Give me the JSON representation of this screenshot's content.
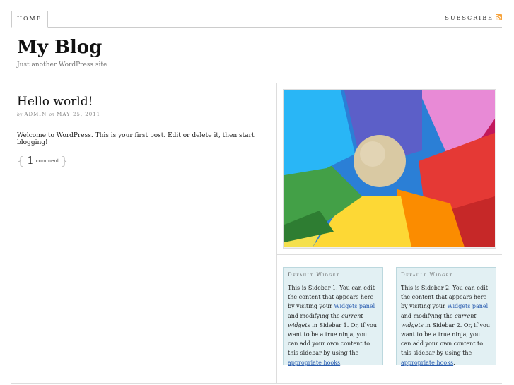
{
  "nav": {
    "home_label": "HOME",
    "subscribe_label": "SUBSCRIBE",
    "rss_icon": "rss-icon",
    "rss_color": "#f7a33b"
  },
  "header": {
    "title": "My Blog",
    "tagline": "Just another WordPress site"
  },
  "post": {
    "title": "Hello world!",
    "meta_by": "by",
    "author": "ADMIN",
    "meta_on": "on",
    "date": "MAY 25, 2011",
    "body": "Welcome to WordPress. This is your first post. Edit or delete it, then start blogging!",
    "comment_count": "1",
    "comment_label": "comment",
    "brace_open": "{",
    "brace_close": "}"
  },
  "sidebar": {
    "image_alt": "Colorful pinwheel with wooden ball",
    "widgets": [
      {
        "title": "Default Widget",
        "text_before": "This is Sidebar 1. You can edit the content that appears here by visiting your ",
        "link1": "Widgets panel",
        "text_mid1": " and modifying the ",
        "em": "current widgets",
        "text_mid2": " in Sidebar 1. Or, if you want to be a true ninja, you can add your own content to this sidebar by using the ",
        "link2": "appropriate hooks",
        "text_end": "."
      },
      {
        "title": "Default Widget",
        "text_before": "This is Sidebar 2. You can edit the content that appears here by visiting your ",
        "link1": "Widgets panel",
        "text_mid1": " and modifying the ",
        "em": "current widgets",
        "text_mid2": " in Sidebar 2. Or, if you want to be a true ninja, you can add your own content to this sidebar by using the ",
        "link2": "appropriate hooks",
        "text_end": "."
      }
    ]
  },
  "colors": {
    "widget_bg": "#e2f0f3",
    "link": "#2a5db0"
  }
}
